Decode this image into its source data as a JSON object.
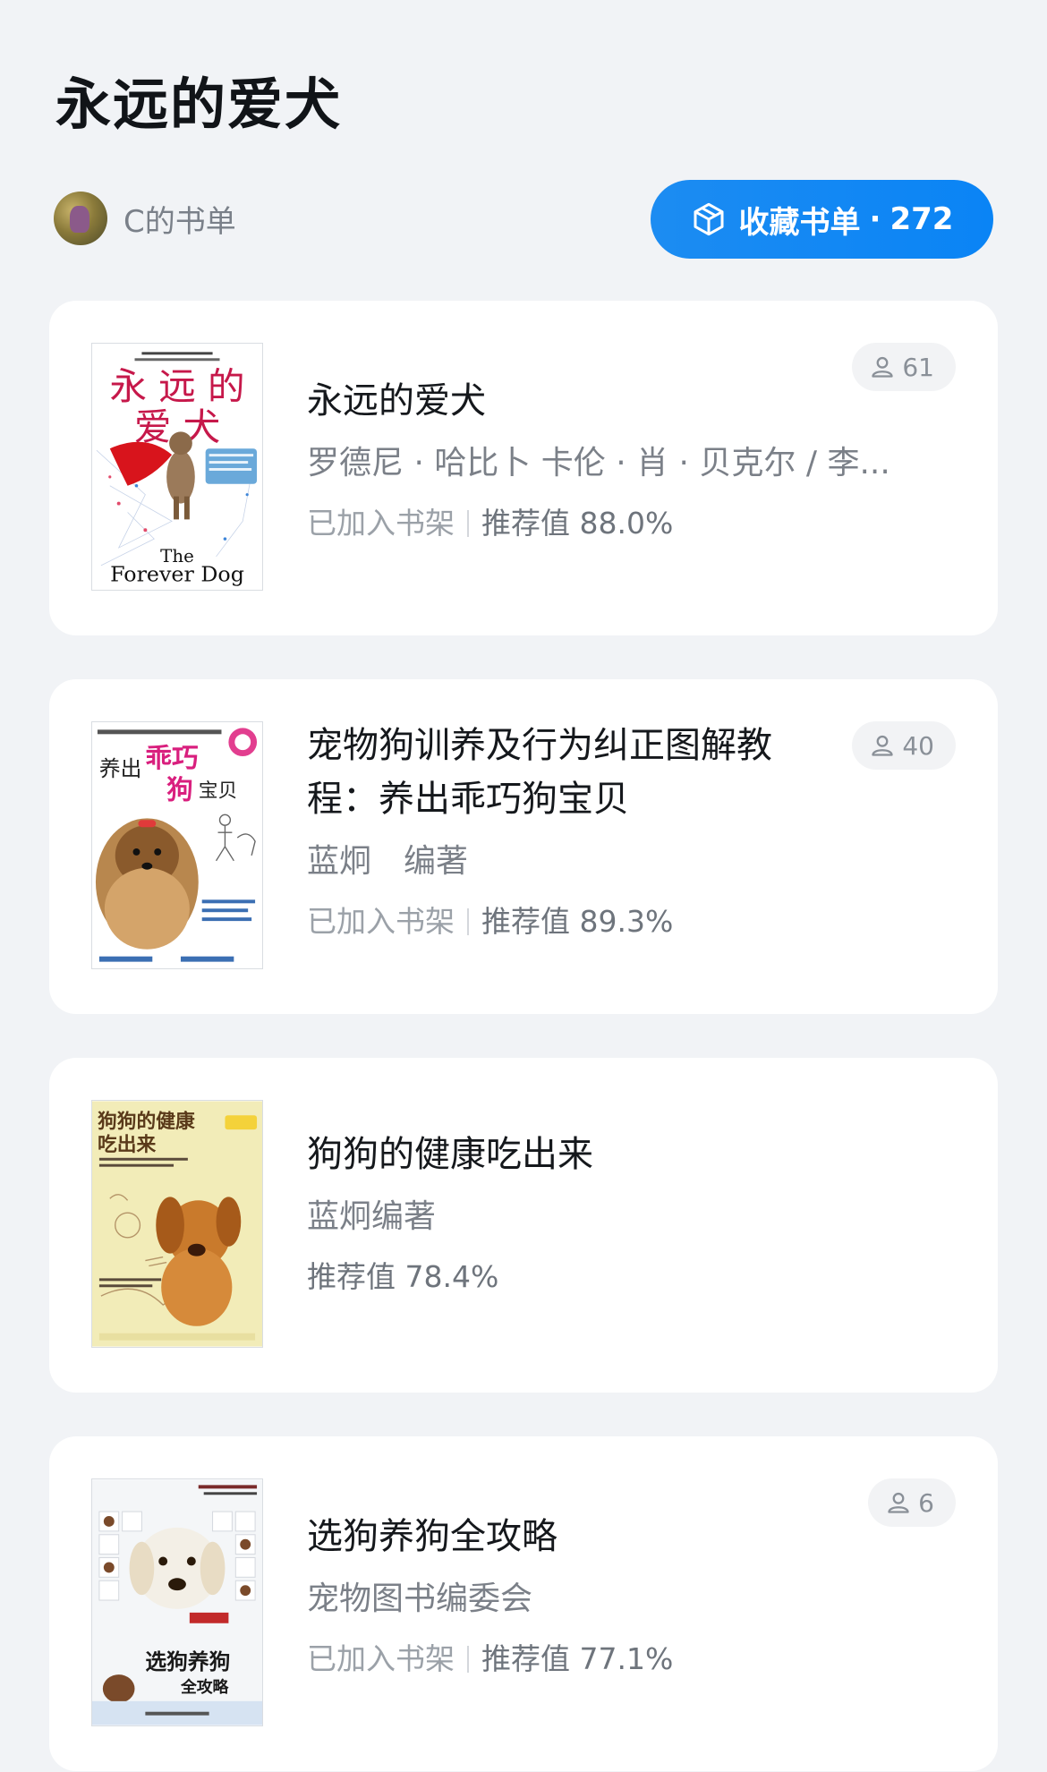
{
  "header": {
    "title": "永远的爱犬",
    "owner_name": "C的书单",
    "collect_label": "收藏书单",
    "collect_separator": "·",
    "collect_count": "272"
  },
  "books": [
    {
      "title": "永远的爱犬",
      "author": "罗德尼 · 哈比卜 卡伦 · 肖 · 贝克尔 / 李...",
      "shelf_status": "已加入书架",
      "recommend": "推荐值 88.0%",
      "readers": "61",
      "cover_icon": "book-cover-forever-dog"
    },
    {
      "title": "宠物狗训养及行为纠正图解教程：养出乖巧狗宝贝",
      "author": "蓝炯　编著",
      "shelf_status": "已加入书架",
      "recommend": "推荐值 89.3%",
      "readers": "40",
      "cover_icon": "book-cover-yorkie"
    },
    {
      "title": "狗狗的健康吃出来",
      "author": "蓝炯编著",
      "shelf_status": "",
      "recommend": "推荐值 78.4%",
      "readers": "",
      "cover_icon": "book-cover-puppy"
    },
    {
      "title": "选狗养狗全攻略",
      "author": "宠物图书编委会",
      "shelf_status": "已加入书架",
      "recommend": "推荐值 77.1%",
      "readers": "6",
      "cover_icon": "book-cover-labrador"
    }
  ],
  "colors": {
    "accent": "#0a84f5",
    "background": "#f1f3f6",
    "card": "#ffffff"
  }
}
